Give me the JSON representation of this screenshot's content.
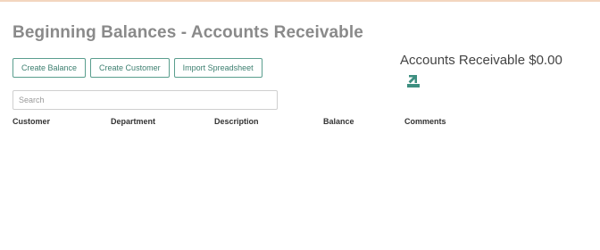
{
  "page": {
    "title": "Beginning Balances - Accounts Receivable"
  },
  "toolbar": {
    "create_balance_label": "Create Balance",
    "create_customer_label": "Create Customer",
    "import_spreadsheet_label": "Import Spreadsheet"
  },
  "search": {
    "placeholder": "Search",
    "value": ""
  },
  "table": {
    "columns": [
      "Customer",
      "Department",
      "Description",
      "Balance",
      "Comments"
    ],
    "rows": []
  },
  "summary": {
    "accounts_receivable_text": "Accounts Receivable $0.00"
  },
  "icons": {
    "export": "export-icon"
  },
  "colors": {
    "accent": "#3d7f70",
    "button_border": "#5a9e8e",
    "title": "#8a8a8a",
    "top_bar": "#f3d6bf"
  }
}
